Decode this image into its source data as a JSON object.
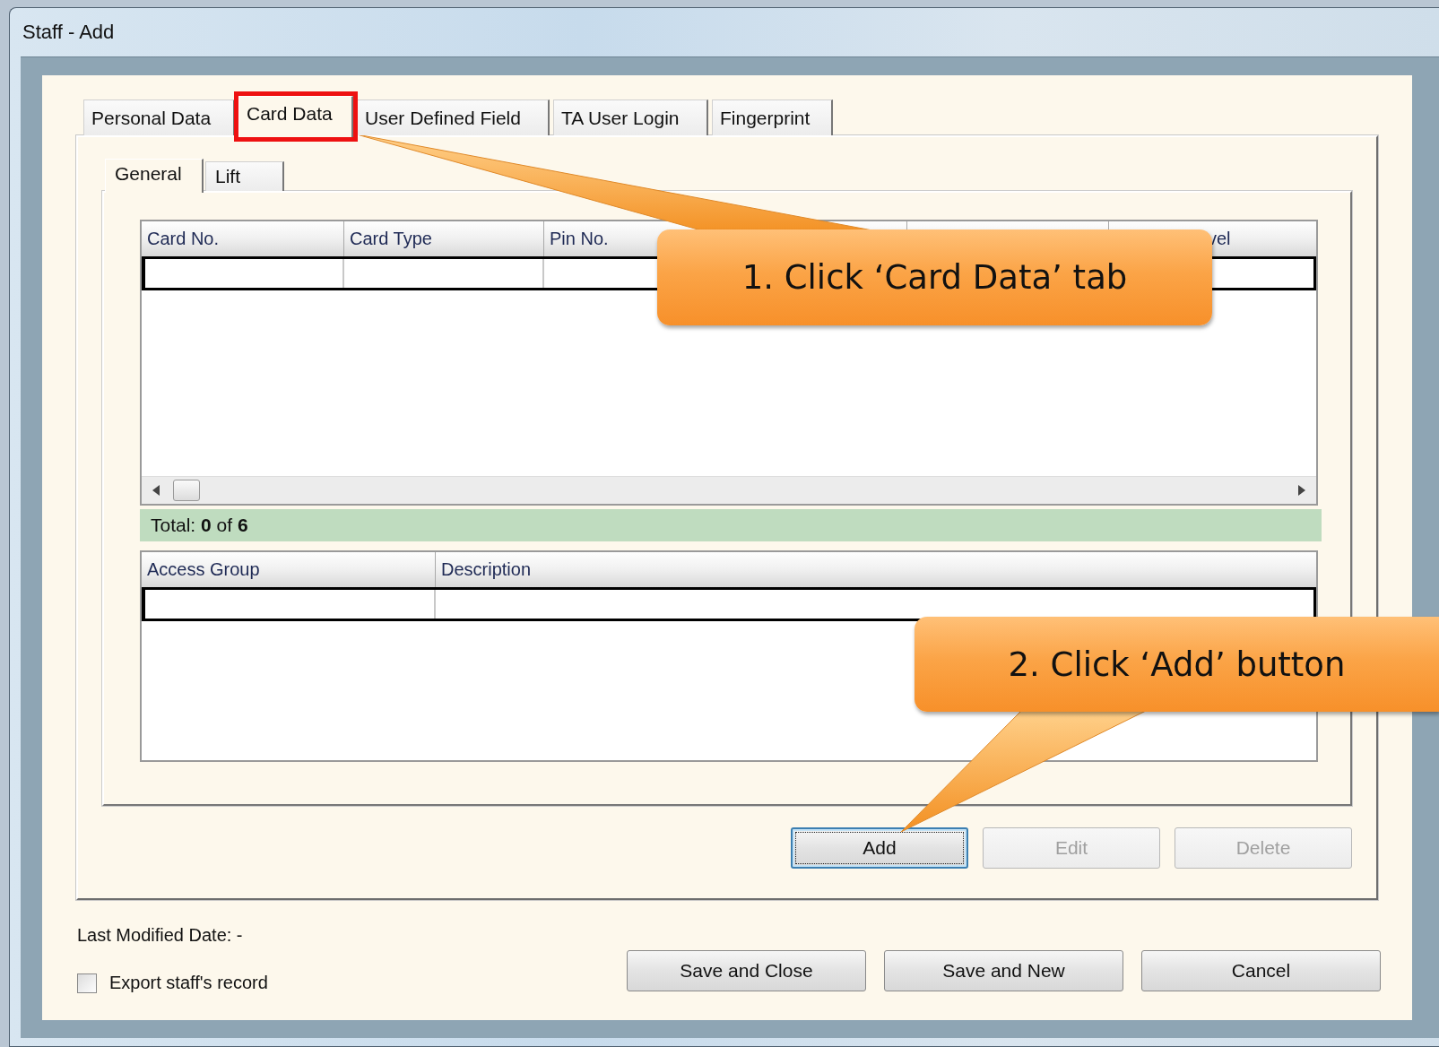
{
  "window": {
    "title": "Staff - Add"
  },
  "tabs": [
    {
      "label": "Personal Data",
      "selected": false,
      "highlighted": false
    },
    {
      "label": "Card Data",
      "selected": true,
      "highlighted": true
    },
    {
      "label": "User Defined Field",
      "selected": false,
      "highlighted": false
    },
    {
      "label": "TA User Login",
      "selected": false,
      "highlighted": false
    },
    {
      "label": "Fingerprint",
      "selected": false,
      "highlighted": false
    }
  ],
  "sub_tabs": [
    {
      "label": "General",
      "selected": true
    },
    {
      "label": "Lift",
      "selected": false
    }
  ],
  "card_table": {
    "columns": [
      {
        "label": "Card No."
      },
      {
        "label": "Card Type"
      },
      {
        "label": "Pin No."
      },
      {},
      {},
      {
        "label": "vel",
        "partial": true
      }
    ],
    "rows": [
      {
        "selected": true
      }
    ]
  },
  "total": "Total: **0** of **6**",
  "access_table": {
    "columns": [
      {
        "label": "Access Group"
      },
      {
        "label": "Description"
      }
    ],
    "rows": [
      {
        "selected": true
      }
    ]
  },
  "actions": [
    {
      "label": "Add",
      "focused": true,
      "disabled": false
    },
    {
      "label": "Edit",
      "focused": false,
      "disabled": true
    },
    {
      "label": "Delete",
      "focused": false,
      "disabled": true
    }
  ],
  "last_modified": "Last Modified Date: -",
  "export_checkbox": {
    "label": "Export staff's record",
    "checked": false
  },
  "footer_buttons": [
    {
      "label": "Save and Close"
    },
    {
      "label": "Save and New"
    },
    {
      "label": "Cancel"
    }
  ],
  "callouts": [
    {
      "text": "1. Click ‘Card Data’ tab"
    },
    {
      "text": "2. Click ‘Add’ button"
    }
  ]
}
